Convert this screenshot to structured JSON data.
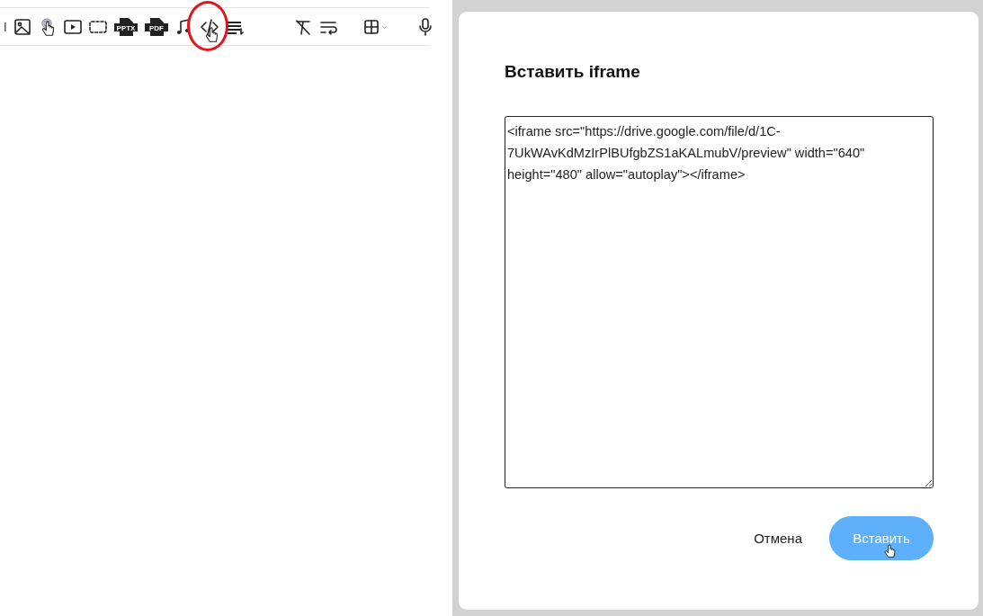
{
  "toolbar": {
    "groups": [
      {
        "items": [
          {
            "kind": "divider"
          },
          {
            "kind": "image"
          },
          {
            "kind": "touch"
          },
          {
            "kind": "video"
          },
          {
            "kind": "selection"
          },
          {
            "kind": "file",
            "label": "PPTX"
          },
          {
            "kind": "file",
            "label": "PDF"
          },
          {
            "kind": "music"
          },
          {
            "kind": "code",
            "highlighted": true
          },
          {
            "kind": "lines"
          }
        ]
      },
      {
        "items": [
          {
            "kind": "clear-format"
          },
          {
            "kind": "wrap"
          }
        ]
      },
      {
        "items": [
          {
            "kind": "table"
          }
        ]
      },
      {
        "items": [
          {
            "kind": "mic"
          }
        ]
      }
    ]
  },
  "dialog": {
    "title": "Вставить iframe",
    "textarea": {
      "value": "<iframe src=\"https://drive.google.com/file/d/1C-7UkWAvKdMzIrPlBUfgbZS1aKALmubV/preview\" width=\"640\" height=\"480\" allow=\"autoplay\"></iframe>"
    },
    "buttons": [
      {
        "label": "Отмена",
        "kind": "text"
      },
      {
        "label": "Вставить",
        "kind": "primary",
        "hovered": true
      }
    ]
  }
}
